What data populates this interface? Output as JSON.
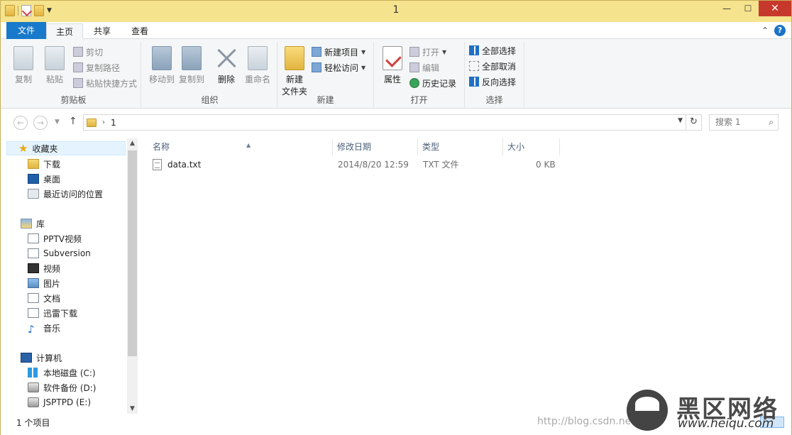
{
  "window": {
    "title": "1",
    "minimize": "—",
    "maximize": "☐",
    "close": "✕"
  },
  "tabs": {
    "file": "文件",
    "home": "主页",
    "share": "共享",
    "view": "查看",
    "collapse": "⌃",
    "help": "?"
  },
  "ribbon": {
    "clipboard": {
      "label": "剪贴板",
      "copy": "复制",
      "paste": "粘贴",
      "cut": "剪切",
      "copy_path": "复制路径",
      "paste_shortcut": "粘贴快捷方式"
    },
    "organize": {
      "label": "组织",
      "move_to": "移动到",
      "copy_to": "复制到",
      "delete": "删除",
      "rename": "重命名"
    },
    "new": {
      "label": "新建",
      "new_folder_line1": "新建",
      "new_folder_line2": "文件夹",
      "new_item": "新建项目",
      "easy_access": "轻松访问"
    },
    "open": {
      "label": "打开",
      "properties": "属性",
      "open": "打开",
      "edit": "编辑",
      "history": "历史记录"
    },
    "select": {
      "label": "选择",
      "select_all": "全部选择",
      "select_none": "全部取消",
      "invert": "反向选择"
    }
  },
  "address": {
    "back": "←",
    "forward": "→",
    "up": "↑",
    "path_sep": "›",
    "path": "1",
    "refresh": "↻",
    "search_placeholder": "搜索 1",
    "search_icon": "⌕"
  },
  "nav": {
    "favorites": "收藏夹",
    "downloads": "下载",
    "desktop": "桌面",
    "recent": "最近访问的位置",
    "libraries": "库",
    "pptv": "PPTV视频",
    "subversion": "Subversion",
    "videos": "视频",
    "pictures": "图片",
    "documents": "文档",
    "xunlei": "迅雷下载",
    "music": "音乐",
    "computer": "计算机",
    "drive_c": "本地磁盘 (C:)",
    "drive_d": "软件备份 (D:)",
    "drive_e": "JSPTPD (E:)"
  },
  "columns": {
    "name": "名称",
    "modified": "修改日期",
    "type": "类型",
    "size": "大小"
  },
  "files": [
    {
      "name": "data.txt",
      "modified": "2014/8/20 12:59",
      "type": "TXT 文件",
      "size": "0 KB"
    }
  ],
  "status": {
    "count": "1 个项目"
  },
  "watermark": {
    "site_cn": "黑区网络",
    "site_url": "www.heiqu.com",
    "blog": "http://blog.csdn.net/"
  }
}
